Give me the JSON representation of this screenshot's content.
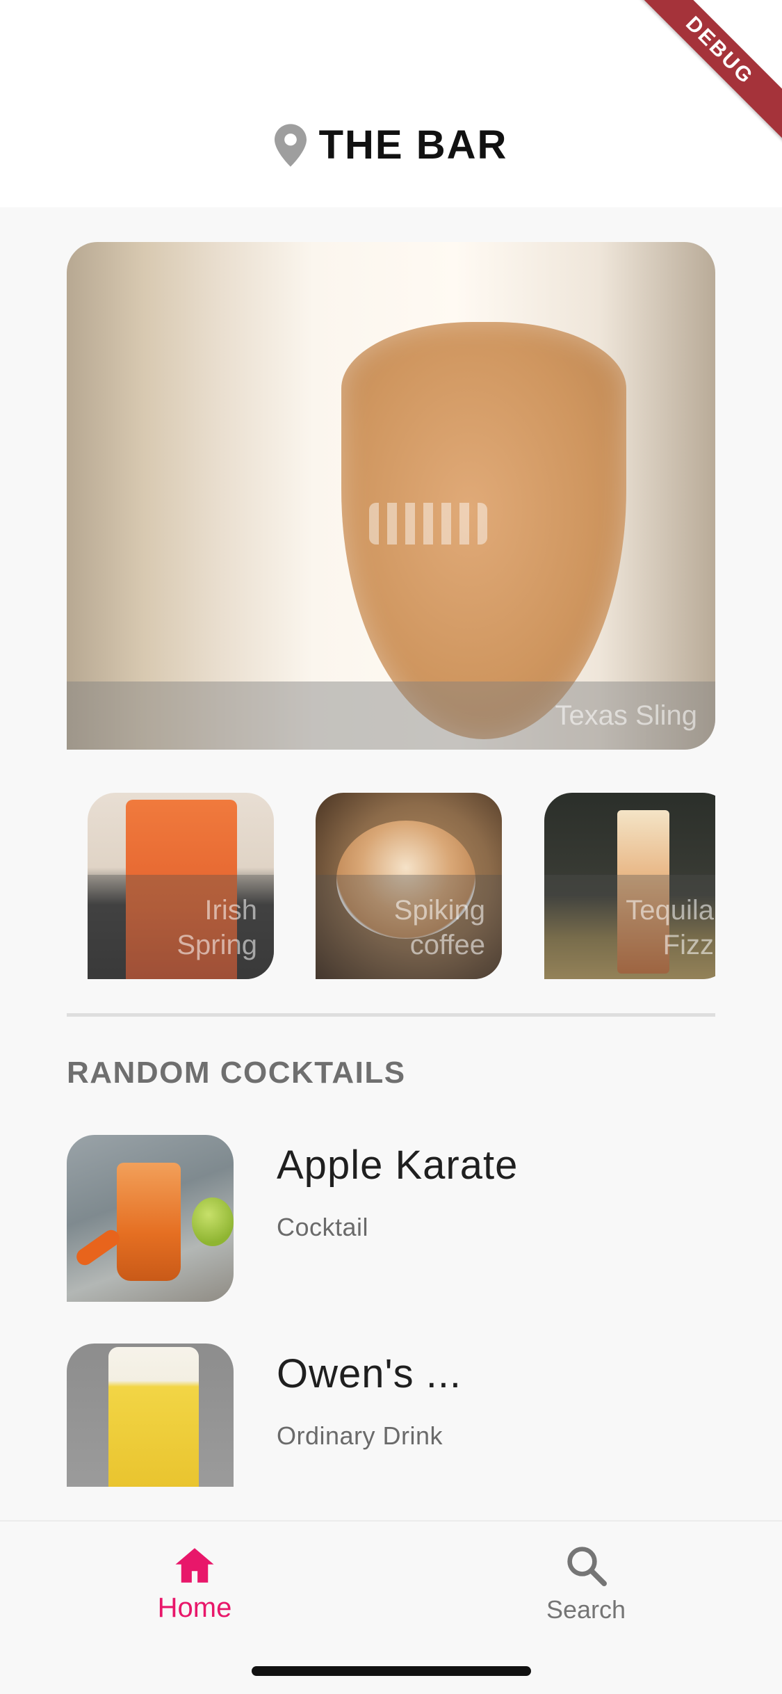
{
  "app": {
    "title": "THE BAR",
    "debug_label": "DEBUG"
  },
  "featured": {
    "name": "Texas Sling"
  },
  "carousel": {
    "items": [
      {
        "line1": "Irish",
        "line2": "Spring"
      },
      {
        "line1": "Spiking",
        "line2": "coffee"
      },
      {
        "line1": "Tequila",
        "line2": "Fizz"
      }
    ]
  },
  "random_section": {
    "title": "RANDOM COCKTAILS",
    "items": [
      {
        "name": "Apple Karate",
        "category": "Cocktail"
      },
      {
        "name": "Owen's ...",
        "category": "Ordinary Drink"
      }
    ]
  },
  "bottom_nav": {
    "home": "Home",
    "search": "Search",
    "active": "home",
    "active_color": "#e8176a",
    "inactive_color": "#757575"
  },
  "icons": {
    "title": "location-pin-icon",
    "home": "home-icon",
    "search": "search-icon"
  }
}
